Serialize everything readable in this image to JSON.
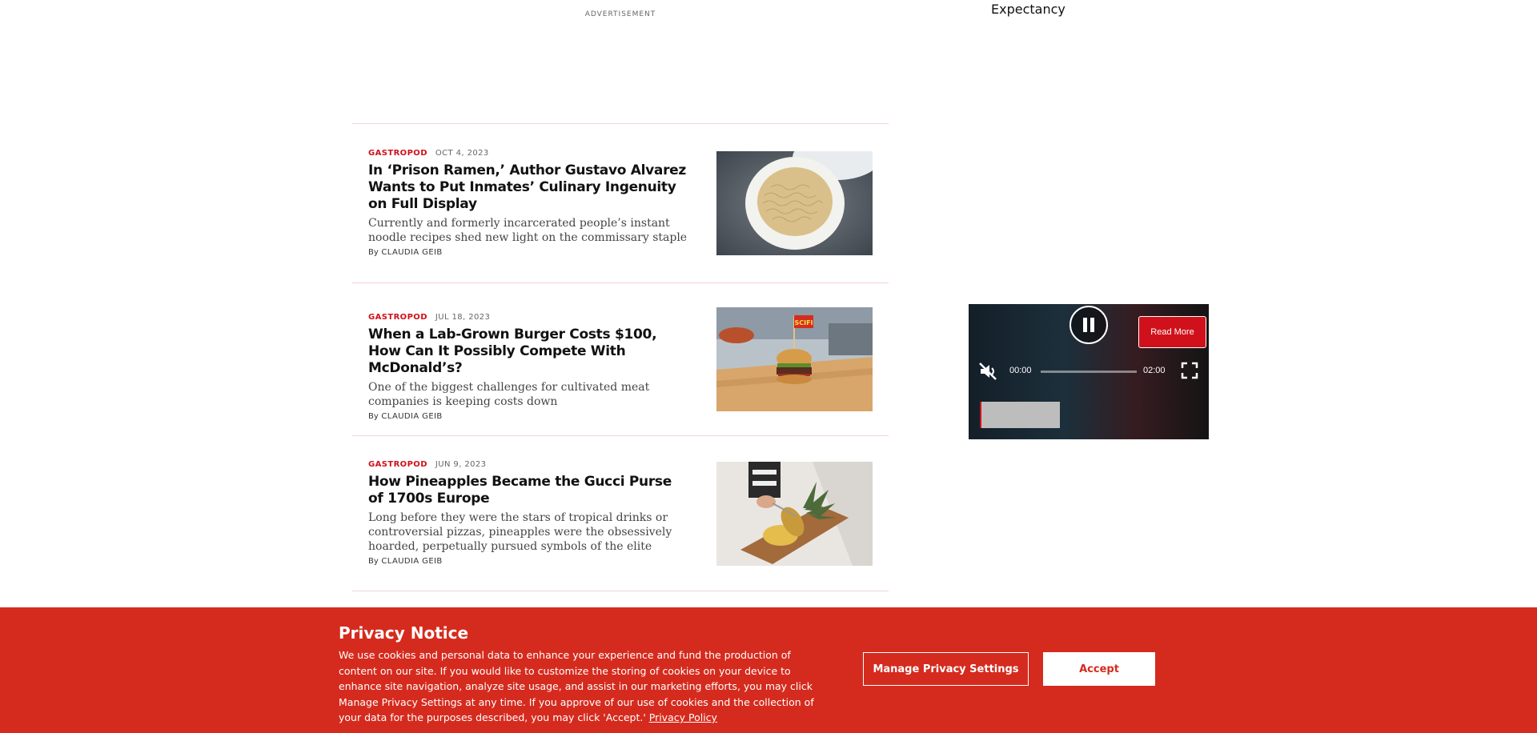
{
  "ad": {
    "label": "ADVERTISEMENT"
  },
  "sidebar": {
    "partial_title": "Expectancy"
  },
  "articles": [
    {
      "category": "GASTROPOD",
      "date": "OCT 4, 2023",
      "headline": "In ‘Prison Ramen,’ Author Gustavo Alvarez Wants to Put Inmates’ Culinary Ingenuity on Full Display",
      "dek": "Currently and formerly incarcerated people’s instant noodle recipes shed new light on the commissary staple",
      "by": "By",
      "author": "CLAUDIA GEIB"
    },
    {
      "category": "GASTROPOD",
      "date": "JUL 18, 2023",
      "headline": "When a Lab-Grown Burger Costs $100, How Can It Possibly Compete With McDonald’s?",
      "dek": "One of the biggest challenges for cultivated meat companies is keeping costs down",
      "by": "By",
      "author": "CLAUDIA GEIB",
      "flag_text": "SCIFI"
    },
    {
      "category": "GASTROPOD",
      "date": "JUN 9, 2023",
      "headline": "How Pineapples Became the Gucci Purse of 1700s Europe",
      "dek": "Long before they were the stars of tropical drinks or controversial pizzas, pineapples were the obsessively hoarded, perpetually pursued symbols of the elite",
      "by": "By",
      "author": "CLAUDIA GEIB"
    }
  ],
  "player": {
    "read_more": "Read More",
    "current_time": "00:00",
    "duration": "02:00",
    "progress": 0
  },
  "privacy": {
    "title": "Privacy Notice",
    "body": "We use cookies and personal data to enhance your experience and fund the production of content on our site. If you would like to customize the storing of cookies on your device to enhance site navigation, analyze site usage, and assist in our marketing efforts, you may click Manage Privacy Settings at any time. If you approve of our use of cookies and the collection of your data for the purposes described, you may click 'Accept.'",
    "policy_link": "Privacy Policy",
    "manage_button": "Manage Privacy Settings",
    "accept_button": "Accept"
  },
  "colors": {
    "accent": "#d0111b",
    "banner": "#d52b1e",
    "divider": "#f1d4d7"
  }
}
